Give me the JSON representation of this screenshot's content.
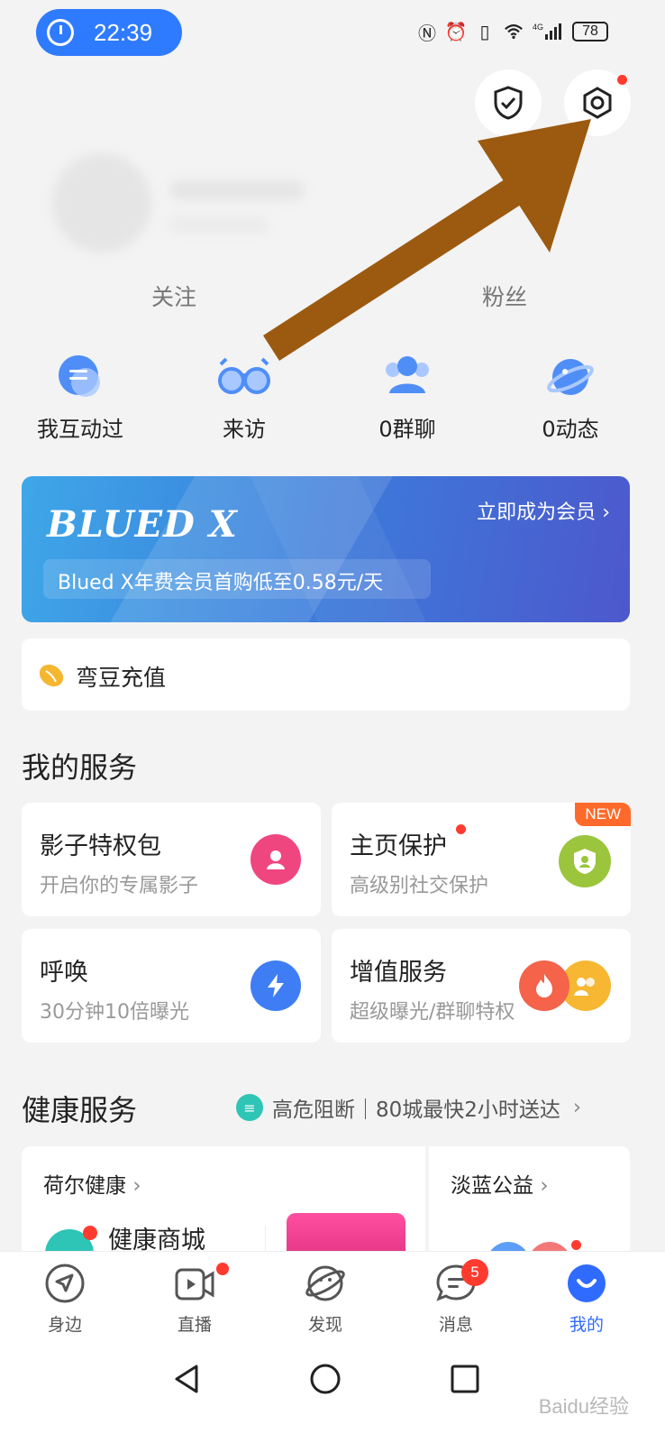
{
  "status_bar": {
    "time": "22:39",
    "battery": "78",
    "network": "4G"
  },
  "profile": {
    "follow_label": "关注",
    "fans_label": "粉丝"
  },
  "quick_actions": [
    {
      "label": "我互动过",
      "icon": "chat-bubble-icon"
    },
    {
      "label": "来访",
      "icon": "glasses-icon"
    },
    {
      "label": "0群聊",
      "icon": "group-icon"
    },
    {
      "label": "0动态",
      "icon": "planet-icon"
    }
  ],
  "vip_banner": {
    "logo": "BLUED X",
    "cta": "立即成为会员",
    "desc": "Blued X年费会员首购低至0.58元/天"
  },
  "recharge": {
    "label": "弯豆充值"
  },
  "services": {
    "title": "我的服务",
    "items": [
      {
        "title": "影子特权包",
        "subtitle": "开启你的专属影子",
        "icon": "shadow-user-icon",
        "color": "#f0467f"
      },
      {
        "title": "主页保护",
        "subtitle": "高级别社交保护",
        "icon": "profile-shield-icon",
        "color": "#9bc53d",
        "badge": "NEW"
      },
      {
        "title": "呼唤",
        "subtitle": "30分钟10倍曝光",
        "icon": "lightning-icon",
        "color": "#3f7df4"
      },
      {
        "title": "增值服务",
        "subtitle": "超级曝光/群聊特权",
        "icon": "fire-icon",
        "color": "#f4634a"
      }
    ]
  },
  "health": {
    "title": "健康服务",
    "promo": "高危阻断｜80城最快2小时送达",
    "left_card_title": "荷尔健康",
    "left_card_item": "健康商城",
    "right_card_title": "淡蓝公益"
  },
  "bottom_nav": [
    {
      "label": "身边",
      "icon": "navigation-arrow-icon"
    },
    {
      "label": "直播",
      "icon": "video-camera-icon"
    },
    {
      "label": "发现",
      "icon": "planet-face-icon"
    },
    {
      "label": "消息",
      "icon": "message-icon",
      "badge": "5"
    },
    {
      "label": "我的",
      "icon": "profile-face-icon",
      "active": true
    }
  ],
  "watermark": "Baidu经验"
}
